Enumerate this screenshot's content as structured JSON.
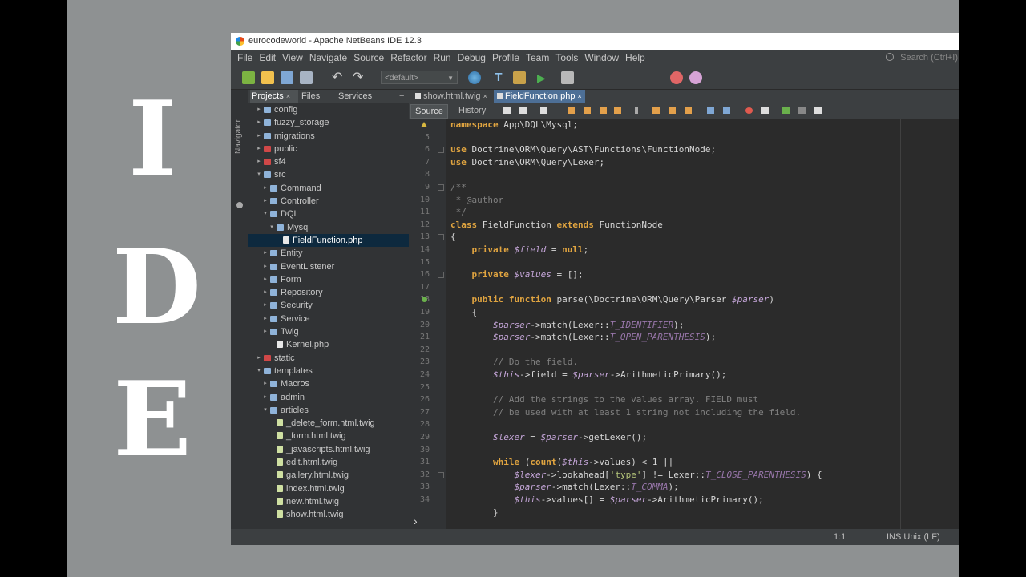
{
  "overlay": {
    "letters": [
      "I",
      "D",
      "E"
    ]
  },
  "window": {
    "title": "eurocodeworld - Apache NetBeans IDE 12.3"
  },
  "menubar": {
    "items": [
      "File",
      "Edit",
      "View",
      "Navigate",
      "Source",
      "Refactor",
      "Run",
      "Debug",
      "Profile",
      "Team",
      "Tools",
      "Window",
      "Help"
    ],
    "search_placeholder": "Search (Ctrl+I)"
  },
  "toolbar": {
    "config": "<default>",
    "icons": [
      "new-project-icon",
      "new-file-icon",
      "open-project-icon",
      "close-project-icon",
      "undo-icon",
      "redo-icon",
      "globe-icon",
      "build-icon",
      "clean-build-icon",
      "run-icon",
      "debug-icon",
      "profile-icon",
      "gc-icon",
      "cancel-icon"
    ]
  },
  "left_strip": {
    "label": "Navigator"
  },
  "project_panel": {
    "tabs": [
      "Projects",
      "Files",
      "Services"
    ],
    "tree": [
      {
        "label": "config",
        "indent": 1,
        "toggle": "▸",
        "icon": "folder"
      },
      {
        "label": "fuzzy_storage",
        "indent": 1,
        "toggle": "▸",
        "icon": "folder"
      },
      {
        "label": "migrations",
        "indent": 1,
        "toggle": "▸",
        "icon": "folder"
      },
      {
        "label": "public",
        "indent": 1,
        "toggle": "▸",
        "icon": "red"
      },
      {
        "label": "sf4",
        "indent": 1,
        "toggle": "▸",
        "icon": "red"
      },
      {
        "label": "src",
        "indent": 1,
        "toggle": "▾",
        "icon": "folder"
      },
      {
        "label": "Command",
        "indent": 2,
        "toggle": "▸",
        "icon": "folder"
      },
      {
        "label": "Controller",
        "indent": 2,
        "toggle": "▸",
        "icon": "folder"
      },
      {
        "label": "DQL",
        "indent": 2,
        "toggle": "▾",
        "icon": "folder"
      },
      {
        "label": "Mysql",
        "indent": 3,
        "toggle": "▾",
        "icon": "folder"
      },
      {
        "label": "FieldFunction.php",
        "indent": 4,
        "toggle": "",
        "icon": "file",
        "selected": true
      },
      {
        "label": "Entity",
        "indent": 2,
        "toggle": "▸",
        "icon": "folder"
      },
      {
        "label": "EventListener",
        "indent": 2,
        "toggle": "▸",
        "icon": "folder"
      },
      {
        "label": "Form",
        "indent": 2,
        "toggle": "▸",
        "icon": "folder"
      },
      {
        "label": "Repository",
        "indent": 2,
        "toggle": "▸",
        "icon": "folder"
      },
      {
        "label": "Security",
        "indent": 2,
        "toggle": "▸",
        "icon": "folder"
      },
      {
        "label": "Service",
        "indent": 2,
        "toggle": "▸",
        "icon": "folder"
      },
      {
        "label": "Twig",
        "indent": 2,
        "toggle": "▸",
        "icon": "folder"
      },
      {
        "label": "Kernel.php",
        "indent": 3,
        "toggle": "",
        "icon": "file"
      },
      {
        "label": "static",
        "indent": 1,
        "toggle": "▸",
        "icon": "red"
      },
      {
        "label": "templates",
        "indent": 1,
        "toggle": "▾",
        "icon": "folder"
      },
      {
        "label": "Macros",
        "indent": 2,
        "toggle": "▸",
        "icon": "folder"
      },
      {
        "label": "admin",
        "indent": 2,
        "toggle": "▸",
        "icon": "folder"
      },
      {
        "label": "articles",
        "indent": 2,
        "toggle": "▾",
        "icon": "folder"
      },
      {
        "label": "_delete_form.html.twig",
        "indent": 3,
        "toggle": "",
        "icon": "twig"
      },
      {
        "label": "_form.html.twig",
        "indent": 3,
        "toggle": "",
        "icon": "twig"
      },
      {
        "label": "_javascripts.html.twig",
        "indent": 3,
        "toggle": "",
        "icon": "twig"
      },
      {
        "label": "edit.html.twig",
        "indent": 3,
        "toggle": "",
        "icon": "twig"
      },
      {
        "label": "gallery.html.twig",
        "indent": 3,
        "toggle": "",
        "icon": "twig"
      },
      {
        "label": "index.html.twig",
        "indent": 3,
        "toggle": "",
        "icon": "twig"
      },
      {
        "label": "new.html.twig",
        "indent": 3,
        "toggle": "",
        "icon": "twig"
      },
      {
        "label": "show.html.twig",
        "indent": 3,
        "toggle": "",
        "icon": "twig"
      }
    ]
  },
  "editor": {
    "tabs": [
      {
        "label": "show.html.twig",
        "active": false
      },
      {
        "label": "FieldFunction.php",
        "active": true
      }
    ],
    "source_tab": "Source",
    "history_tab": "History",
    "lines": [
      {
        "num": "",
        "text": "namespace App\\DQL\\Mysql;",
        "mark": "warn"
      },
      {
        "num": "5",
        "text": "",
        "mark": ""
      },
      {
        "num": "6",
        "text": "use Doctrine\\ORM\\Query\\AST\\Functions\\FunctionNode;",
        "mark": "fold"
      },
      {
        "num": "7",
        "text": "use Doctrine\\ORM\\Query\\Lexer;",
        "mark": ""
      },
      {
        "num": "8",
        "text": "",
        "mark": ""
      },
      {
        "num": "9",
        "text": "/**",
        "mark": "fold"
      },
      {
        "num": "10",
        "text": " * @author",
        "mark": ""
      },
      {
        "num": "11",
        "text": " */",
        "mark": ""
      },
      {
        "num": "12",
        "text": "class FieldFunction extends FunctionNode",
        "mark": ""
      },
      {
        "num": "13",
        "text": "{",
        "mark": "fold"
      },
      {
        "num": "14",
        "text": "    private $field = null;",
        "mark": ""
      },
      {
        "num": "15",
        "text": "",
        "mark": ""
      },
      {
        "num": "16",
        "text": "    private $values = [];",
        "mark": "fold"
      },
      {
        "num": "17",
        "text": "",
        "mark": ""
      },
      {
        "num": "18",
        "text": "    public function parse(\\Doctrine\\ORM\\Query\\Parser $parser)",
        "mark": "ovr"
      },
      {
        "num": "19",
        "text": "    {",
        "mark": ""
      },
      {
        "num": "20",
        "text": "        $parser->match(Lexer::T_IDENTIFIER);",
        "mark": ""
      },
      {
        "num": "21",
        "text": "        $parser->match(Lexer::T_OPEN_PARENTHESIS);",
        "mark": ""
      },
      {
        "num": "22",
        "text": "",
        "mark": ""
      },
      {
        "num": "23",
        "text": "        // Do the field.",
        "mark": ""
      },
      {
        "num": "24",
        "text": "        $this->field = $parser->ArithmeticPrimary();",
        "mark": ""
      },
      {
        "num": "25",
        "text": "",
        "mark": ""
      },
      {
        "num": "26",
        "text": "        // Add the strings to the values array. FIELD must",
        "mark": ""
      },
      {
        "num": "27",
        "text": "        // be used with at least 1 string not including the field.",
        "mark": ""
      },
      {
        "num": "28",
        "text": "",
        "mark": ""
      },
      {
        "num": "29",
        "text": "        $lexer = $parser->getLexer();",
        "mark": ""
      },
      {
        "num": "30",
        "text": "",
        "mark": ""
      },
      {
        "num": "31",
        "text": "        while (count($this->values) < 1 ||",
        "mark": ""
      },
      {
        "num": "32",
        "text": "            $lexer->lookahead['type'] != Lexer::T_CLOSE_PARENTHESIS) {",
        "mark": "fold"
      },
      {
        "num": "33",
        "text": "            $parser->match(Lexer::T_COMMA);",
        "mark": ""
      },
      {
        "num": "34",
        "text": "            $this->values[] = $parser->ArithmeticPrimary();",
        "mark": ""
      },
      {
        "num": "",
        "text": "        }",
        "mark": ""
      }
    ]
  },
  "statusbar": {
    "position": "1:1",
    "mode": "INS Unix (LF)"
  },
  "colors": {
    "background": "#8e9192",
    "ide_bg": "#2b2b2b",
    "accent": "#4d6f96",
    "keyword": "#e0a440"
  }
}
